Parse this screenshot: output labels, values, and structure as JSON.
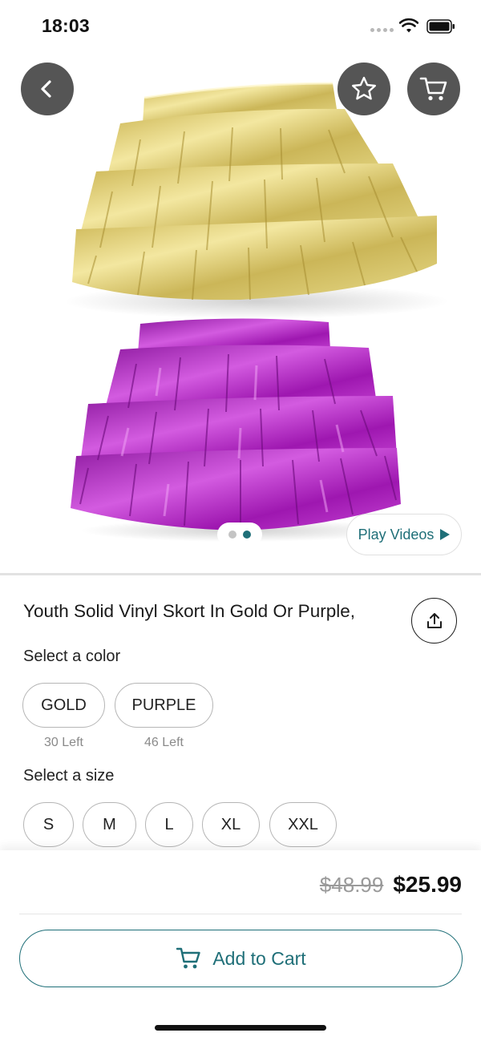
{
  "status_bar": {
    "time": "18:03",
    "icons": [
      "signal-icon",
      "wifi-icon",
      "battery-icon"
    ]
  },
  "hero": {
    "images": [
      "gold-ruffle-skort",
      "purple-ruffle-skort"
    ],
    "current_image_index": 1,
    "image_count": 2,
    "play_videos_label": "Play Videos",
    "buttons": [
      "back-icon",
      "star-icon",
      "cart-icon"
    ]
  },
  "product": {
    "title": "Youth Solid Vinyl Skort In Gold Or Purple,",
    "color_label": "Select a color",
    "colors": [
      {
        "name": "GOLD",
        "stock": "30 Left"
      },
      {
        "name": "PURPLE",
        "stock": "46 Left"
      }
    ],
    "size_label": "Select a size",
    "sizes": [
      "S",
      "M",
      "L",
      "XL",
      "XXL"
    ]
  },
  "purchase": {
    "original_price": "$48.99",
    "sale_price": "$25.99",
    "add_to_cart_label": "Add to Cart"
  },
  "colors": {
    "accent": "#1f6f78",
    "button_bg": "#555555",
    "gold": "#d9c869",
    "purple": "#a51bb5"
  }
}
